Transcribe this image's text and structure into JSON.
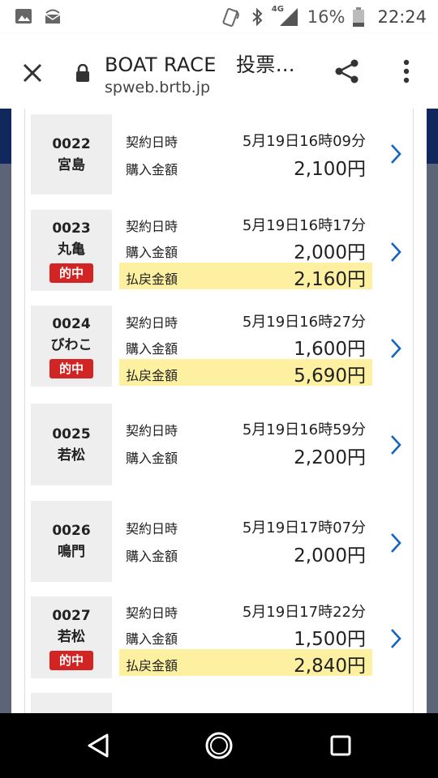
{
  "status_bar": {
    "network": "4G",
    "battery": "16%",
    "time": "22:24"
  },
  "browser": {
    "title": "BOAT RACE　投票…",
    "url": "spweb.brtb.jp"
  },
  "labels": {
    "contract_datetime": "契約日時",
    "purchase_amount": "購入金額",
    "payout_amount": "払戻金額",
    "hit": "的中"
  },
  "tickets": [
    {
      "code": "0022",
      "venue": "宮島",
      "datetime": "5月19日16時09分",
      "amount": "2,100円",
      "hit": false,
      "payout": ""
    },
    {
      "code": "0023",
      "venue": "丸亀",
      "datetime": "5月19日16時17分",
      "amount": "2,000円",
      "hit": true,
      "payout": "2,160円"
    },
    {
      "code": "0024",
      "venue": "びわこ",
      "datetime": "5月19日16時27分",
      "amount": "1,600円",
      "hit": true,
      "payout": "5,690円"
    },
    {
      "code": "0025",
      "venue": "若松",
      "datetime": "5月19日16時59分",
      "amount": "2,200円",
      "hit": false,
      "payout": ""
    },
    {
      "code": "0026",
      "venue": "鳴門",
      "datetime": "5月19日17時07分",
      "amount": "2,000円",
      "hit": false,
      "payout": ""
    },
    {
      "code": "0027",
      "venue": "若松",
      "datetime": "5月19日17時22分",
      "amount": "1,500円",
      "hit": true,
      "payout": "2,840円"
    }
  ],
  "colors": {
    "hit_badge": "#d32424",
    "payout_highlight": "#fdf0a0",
    "chevron": "#1565c0",
    "venue_box": "#eeeeee"
  },
  "icons": {
    "close": "close-icon",
    "lock": "lock-icon",
    "share": "share-icon",
    "more": "more-vert-icon",
    "row_arrow": "chevron-right-icon"
  }
}
